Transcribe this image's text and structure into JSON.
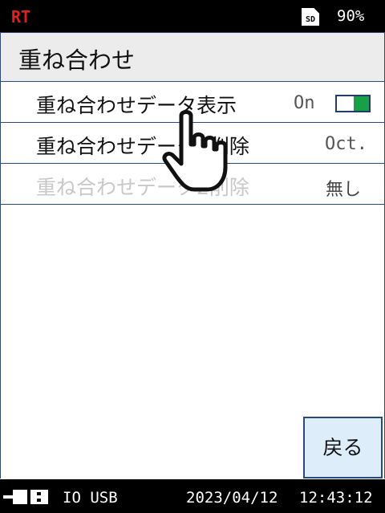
{
  "status_bar": {
    "mode": "RT",
    "sd_label": "SD",
    "battery": "90%"
  },
  "screen": {
    "title": "重ね合わせ"
  },
  "menu": [
    {
      "label": "重ね合わせデータ表示",
      "value": "On",
      "toggle_on": true
    },
    {
      "label": "重ね合わせデータ1削除",
      "value": "Oct."
    },
    {
      "label": "重ね合わせデータ2削除",
      "value": "無し",
      "disabled": true
    }
  ],
  "back_button": {
    "label": "戻る"
  },
  "footer": {
    "interface": "IO USB",
    "date": "2023/04/12",
    "time": "12:43:12"
  },
  "colors": {
    "accent_border": "#2a4a78",
    "toggle_on": "#18a048",
    "mode_text": "#e02020"
  },
  "icons": {
    "pointer": "hand-pointer-icon",
    "sd": "sd-card-icon",
    "connection": "plug-icon"
  }
}
